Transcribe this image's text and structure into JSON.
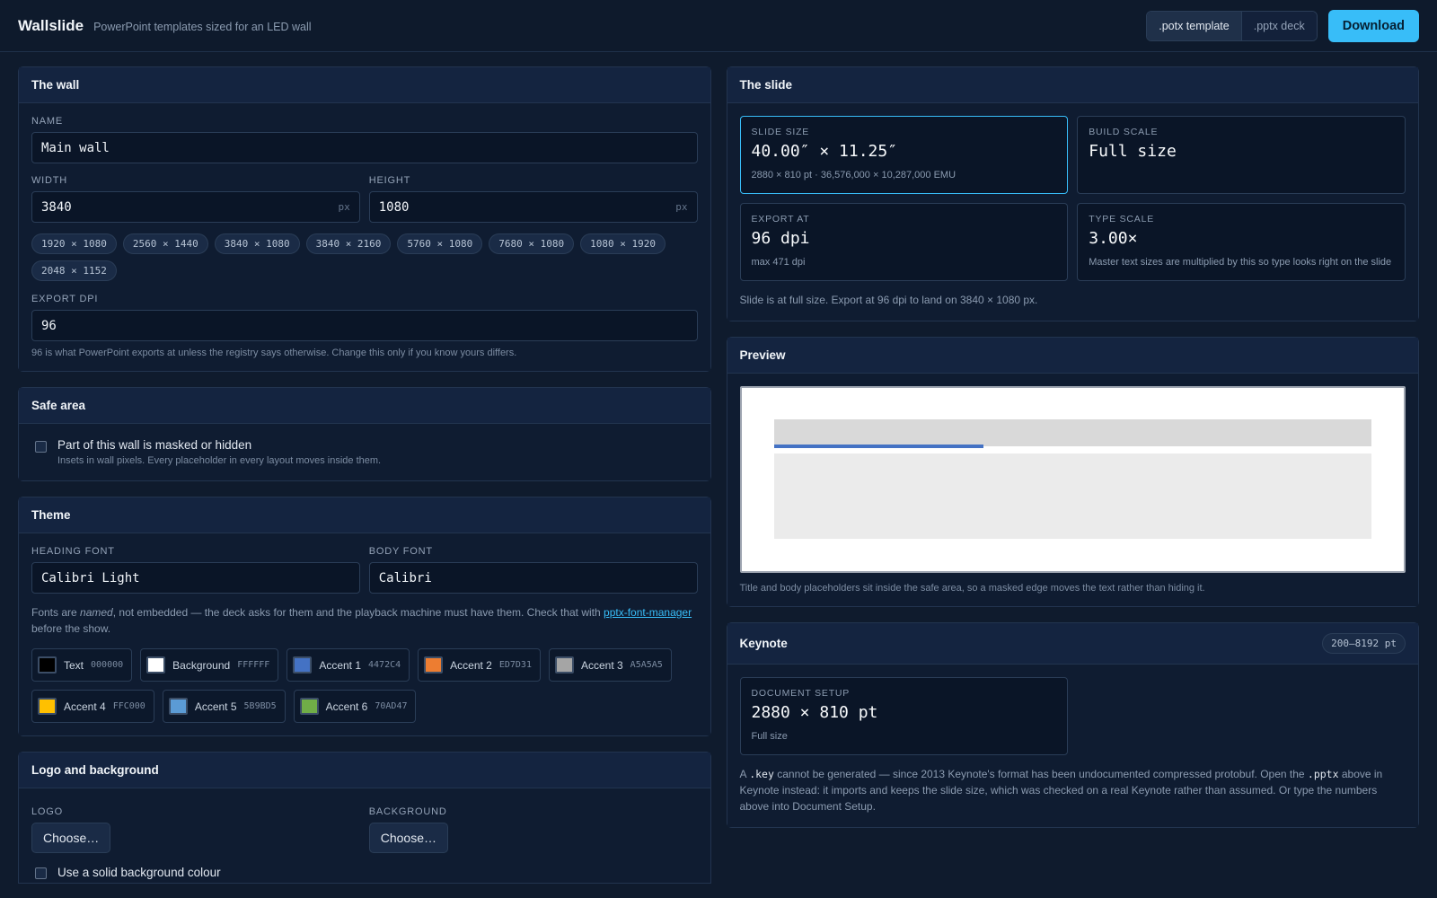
{
  "header": {
    "brand": "Wallslide",
    "tagline": "PowerPoint templates sized for an LED wall",
    "format_options": [
      ".potx template",
      ".pptx deck"
    ],
    "download_label": "Download"
  },
  "wall": {
    "title": "The wall",
    "name_label": "NAME",
    "name_value": "Main wall",
    "width_label": "WIDTH",
    "width_value": "3840",
    "height_label": "HEIGHT",
    "height_value": "1080",
    "unit": "px",
    "presets": [
      "1920 × 1080",
      "2560 × 1440",
      "3840 × 1080",
      "3840 × 2160",
      "5760 × 1080",
      "7680 × 1080",
      "1080 × 1920",
      "2048 × 1152"
    ],
    "dpi_label": "EXPORT DPI",
    "dpi_value": "96",
    "dpi_hint": "96 is what PowerPoint exports at unless the registry says otherwise. Change this only if you know yours differs."
  },
  "safe_area": {
    "title": "Safe area",
    "check_label": "Part of this wall is masked or hidden",
    "check_sub": "Insets in wall pixels. Every placeholder in every layout moves inside them."
  },
  "theme": {
    "title": "Theme",
    "heading_font_label": "HEADING FONT",
    "heading_font_value": "Calibri Light",
    "body_font_label": "BODY FONT",
    "body_font_value": "Calibri",
    "note_pre": "Fonts are ",
    "note_em": "named",
    "note_mid": ", not embedded — the deck asks for them and the playback machine must have them. Check that with ",
    "note_link": "pptx-font-manager",
    "note_post": " before the show.",
    "colors": [
      {
        "name": "Text",
        "hex": "000000",
        "color": "#000000"
      },
      {
        "name": "Background",
        "hex": "FFFFFF",
        "color": "#FFFFFF"
      },
      {
        "name": "Accent 1",
        "hex": "4472C4",
        "color": "#4472C4"
      },
      {
        "name": "Accent 2",
        "hex": "ED7D31",
        "color": "#ED7D31"
      },
      {
        "name": "Accent 3",
        "hex": "A5A5A5",
        "color": "#A5A5A5"
      },
      {
        "name": "Accent 4",
        "hex": "FFC000",
        "color": "#FFC000"
      },
      {
        "name": "Accent 5",
        "hex": "5B9BD5",
        "color": "#5B9BD5"
      },
      {
        "name": "Accent 6",
        "hex": "70AD47",
        "color": "#70AD47"
      }
    ]
  },
  "logo_bg": {
    "title": "Logo and background",
    "logo_label": "LOGO",
    "logo_button": "Choose…",
    "bg_label": "BACKGROUND",
    "bg_button": "Choose…",
    "solid_label": "Use a solid background colour"
  },
  "slide": {
    "title": "The slide",
    "size_label": "SLIDE SIZE",
    "size_value": "40.00″ × 11.25″",
    "size_sub": "2880 × 810 pt · 36,576,000 × 10,287,000 EMU",
    "build_label": "BUILD SCALE",
    "build_value": "Full size",
    "export_label": "EXPORT AT",
    "export_value": "96 dpi",
    "export_sub": "max 471 dpi",
    "type_label": "TYPE SCALE",
    "type_value": "3.00×",
    "type_sub": "Master text sizes are multiplied by this so type looks right on the slide",
    "note": "Slide is at full size. Export at 96 dpi to land on 3840 × 1080 px."
  },
  "preview": {
    "title": "Preview",
    "caption": "Title and body placeholders sit inside the safe area, so a masked edge moves the text rather than hiding it."
  },
  "keynote": {
    "title": "Keynote",
    "badge": "200–8192 pt",
    "doc_label": "DOCUMENT SETUP",
    "doc_value": "2880 × 810 pt",
    "doc_sub": "Full size",
    "text_a": "A ",
    "code_key": ".key",
    "text_b": " cannot be generated — since 2013 Keynote's format has been undocumented compressed protobuf. Open the ",
    "code_pptx": ".pptx",
    "text_c": " above in Keynote instead: it imports and keeps the slide size, which was checked on a real Keynote rather than assumed. Or type the numbers above into Document Setup."
  }
}
